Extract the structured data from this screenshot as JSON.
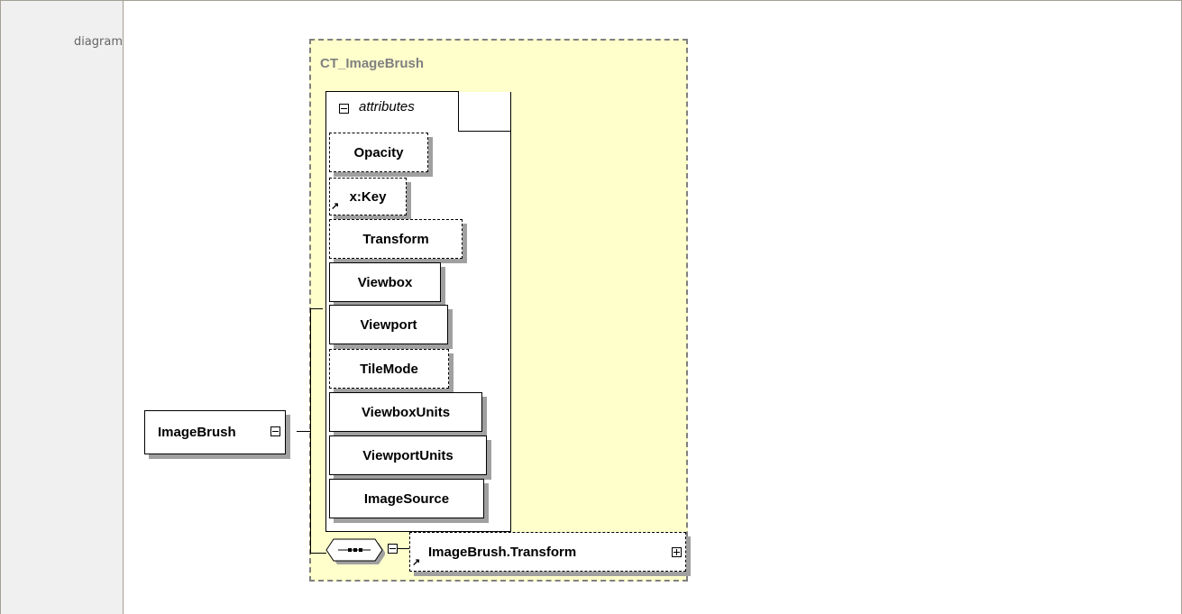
{
  "row_label": "diagram",
  "complex_type": {
    "name": "CT_ImageBrush"
  },
  "attribute_group": {
    "label": "attributes"
  },
  "root_element": {
    "name": "ImageBrush"
  },
  "attributes": [
    {
      "name": "Opacity",
      "optional": true
    },
    {
      "name": "x:Key",
      "optional": true,
      "reference": true
    },
    {
      "name": "Transform",
      "optional": true
    },
    {
      "name": "Viewbox",
      "optional": false
    },
    {
      "name": "Viewport",
      "optional": false
    },
    {
      "name": "TileMode",
      "optional": true
    },
    {
      "name": "ViewboxUnits",
      "optional": false
    },
    {
      "name": "ViewportUnits",
      "optional": false
    },
    {
      "name": "ImageSource",
      "optional": false
    }
  ],
  "sequence_child": {
    "name": "ImageBrush.Transform",
    "optional": true,
    "reference": true
  }
}
